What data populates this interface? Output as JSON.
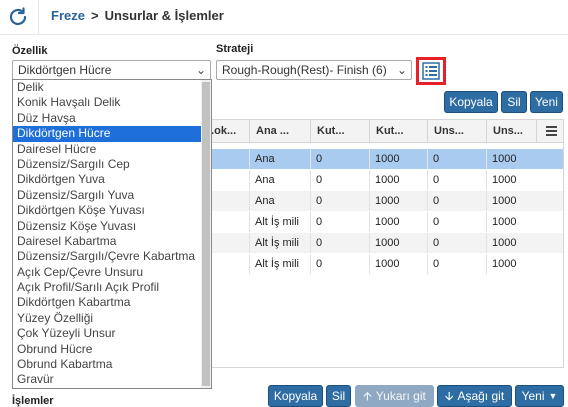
{
  "header": {
    "breadcrumb_root": "Freze",
    "breadcrumb_sep": ">",
    "breadcrumb_current": "Unsurlar & İşlemler"
  },
  "filters": {
    "feature_label": "Özellik",
    "feature_value": "Dikdörtgen Hücre",
    "strategy_label": "Strateji",
    "strategy_value": "Rough-Rough(Rest)- Finish (6)"
  },
  "top_buttons": {
    "copy": "Kopyala",
    "delete": "Sil",
    "new": "Yeni"
  },
  "grid": {
    "columns": [
      "...ok...",
      "Ana ...",
      "Kut...",
      "Kut...",
      "Uns...",
      "Uns..."
    ],
    "rows": [
      [
        "",
        "Ana",
        "0",
        "1000",
        "0",
        "1000"
      ],
      [
        "",
        "Ana",
        "0",
        "1000",
        "0",
        "1000"
      ],
      [
        "",
        "Ana",
        "0",
        "1000",
        "0",
        "1000"
      ],
      [
        "",
        "Alt İş mili",
        "0",
        "1000",
        "0",
        "1000"
      ],
      [
        "",
        "Alt İş mili",
        "0",
        "1000",
        "0",
        "1000"
      ],
      [
        "",
        "Alt İş mili",
        "0",
        "1000",
        "0",
        "1000"
      ]
    ],
    "selected_row": 0
  },
  "dropdown": {
    "items": [
      "Delik",
      "Konik Havşalı Delik",
      "Düz Havşa",
      "Dikdörtgen Hücre",
      "Dairesel Hücre",
      "Düzensiz/Sargılı Cep",
      "Dikdörtgen Yuva",
      "Düzensiz/Sargılı Yuva",
      "Dikdörtgen Köşe Yuvası",
      "Düzensiz Köşe Yuvası",
      "Dairesel Kabartma",
      "Düzensiz/Sargılı/Çevre Kabartma",
      "Açık Cep/Çevre Unsuru",
      "Açık Profil/Sarılı Açık Profil",
      "Dikdörtgen Kabartma",
      "Yüzey Özelliği",
      "Çok Yüzeyli Unsur",
      "Obrund Hücre",
      "Obrund Kabartma",
      "Gravür"
    ],
    "selected_index": 3
  },
  "bottom": {
    "section_label": "İşlemler",
    "copy": "Kopyala",
    "delete": "Sil",
    "move_up": "Yukarı git",
    "move_down": "Aşağı git",
    "new": "Yeni"
  },
  "colors": {
    "accent": "#2e6da4",
    "selection": "#1e6fd9",
    "row_selected": "#a9cbef",
    "highlight_border": "#e8202a"
  }
}
